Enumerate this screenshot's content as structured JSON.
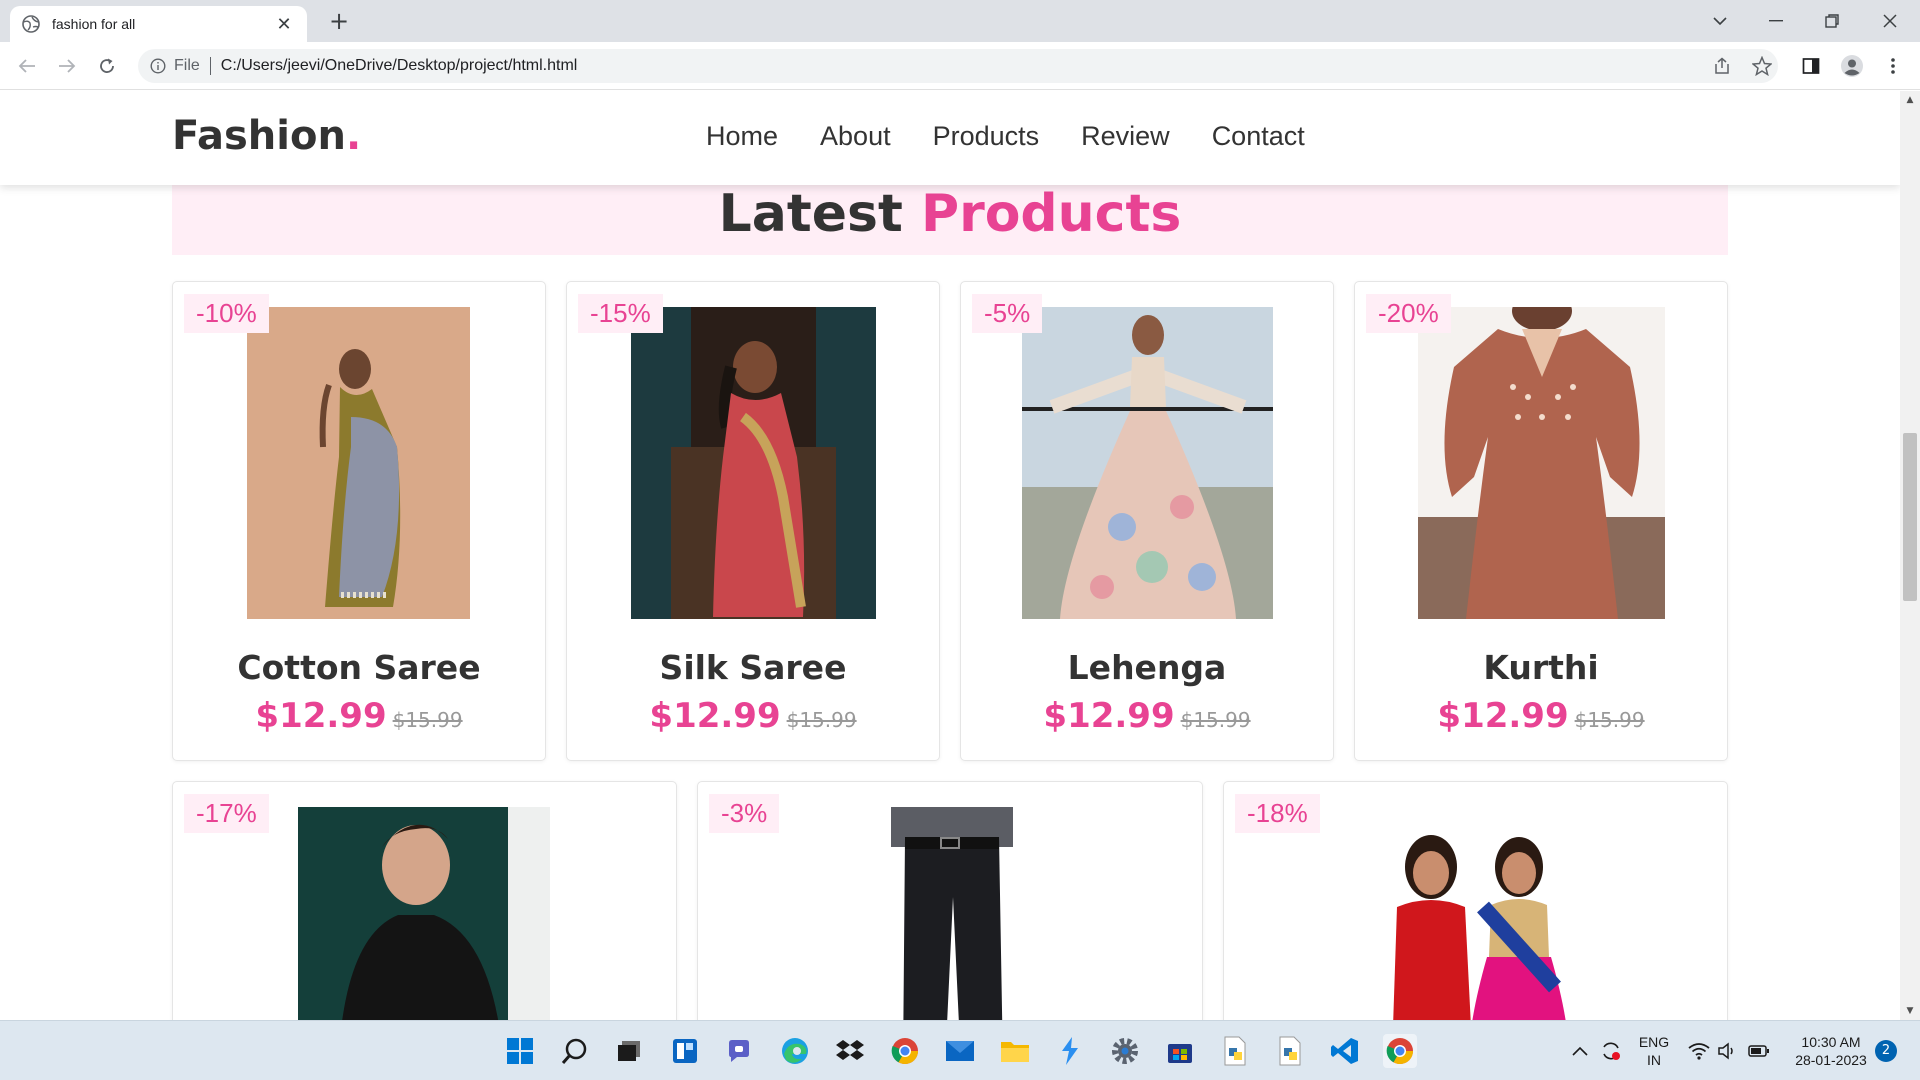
{
  "browser": {
    "tab_title": "fashion for all",
    "new_tab": "+",
    "close_tab": "✕",
    "omnibox_scheme": "File",
    "url": "C:/Users/jeevi/OneDrive/Desktop/project/html.html"
  },
  "site": {
    "logo_text": "Fashion",
    "logo_dot": ".",
    "nav": [
      "Home",
      "About",
      "Products",
      "Review",
      "Contact"
    ]
  },
  "section": {
    "heading_main": "Latest",
    "heading_accent": "Products"
  },
  "products": [
    {
      "discount": "-10%",
      "name": "Cotton Saree",
      "price": "$12.99",
      "old_price": "$15.99"
    },
    {
      "discount": "-15%",
      "name": "Silk Saree",
      "price": "$12.99",
      "old_price": "$15.99"
    },
    {
      "discount": "-5%",
      "name": "Lehenga",
      "price": "$12.99",
      "old_price": "$15.99"
    },
    {
      "discount": "-20%",
      "name": "Kurthi",
      "price": "$12.99",
      "old_price": "$15.99"
    },
    {
      "discount": "-17%"
    },
    {
      "discount": "-3%"
    },
    {
      "discount": "-18%"
    }
  ],
  "taskbar": {
    "lang_top": "ENG",
    "lang_bottom": "IN",
    "time": "10:30 AM",
    "date": "28-01-2023",
    "notifications": "2"
  },
  "colors": {
    "accent": "#e84393",
    "heading_bg": "#ffeef6",
    "text": "#333333"
  }
}
